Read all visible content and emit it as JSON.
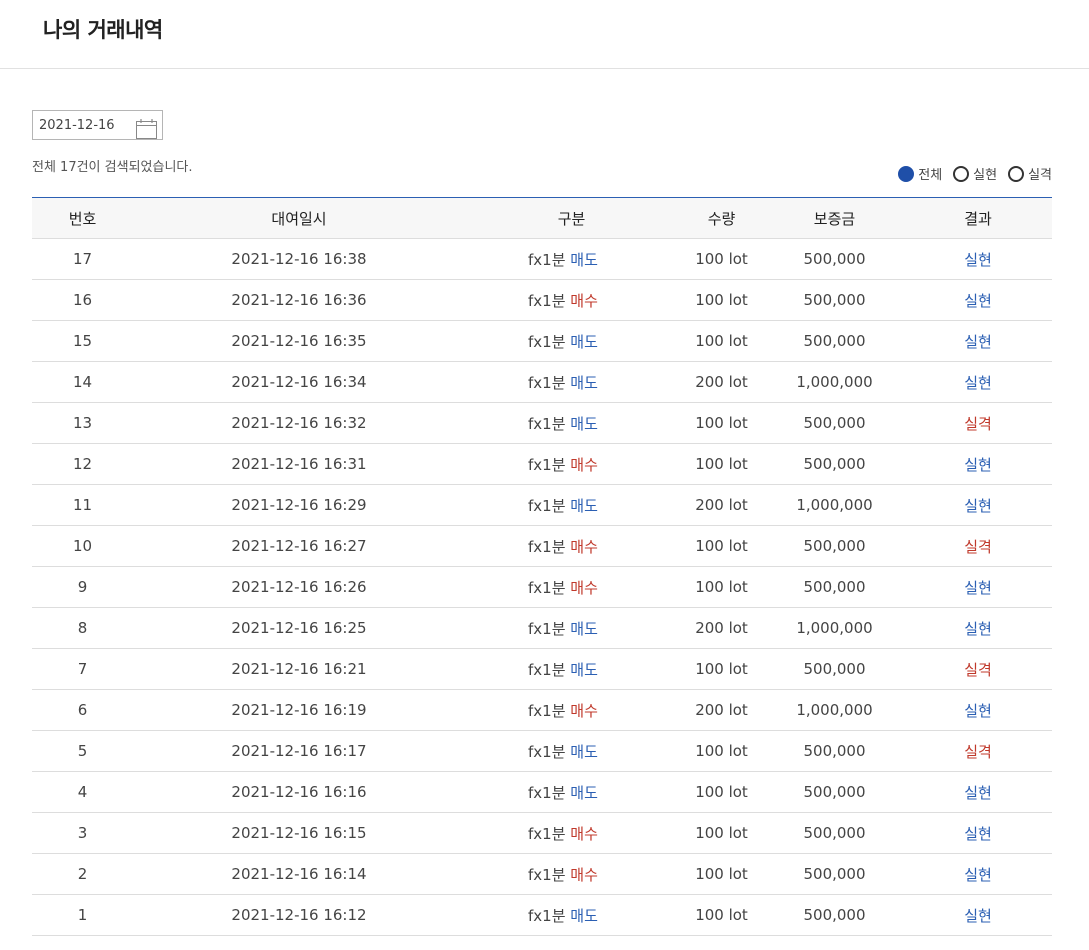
{
  "header": {
    "title": "나의 거래내역"
  },
  "search": {
    "date": "2021-12-16",
    "result_text": "전체 17건이 검색되었습니다."
  },
  "filters": [
    {
      "label": "전체",
      "checked": true
    },
    {
      "label": "실현",
      "checked": false
    },
    {
      "label": "실격",
      "checked": false
    }
  ],
  "table": {
    "columns": [
      "번호",
      "대여일시",
      "구분",
      "수량",
      "보증금",
      "결과"
    ],
    "rows": [
      {
        "no": "17",
        "datetime": "2021-12-16 16:38",
        "product": "fx1분",
        "side": "매도",
        "qty": "100 lot",
        "deposit": "500,000",
        "result": "실현"
      },
      {
        "no": "16",
        "datetime": "2021-12-16 16:36",
        "product": "fx1분",
        "side": "매수",
        "qty": "100 lot",
        "deposit": "500,000",
        "result": "실현"
      },
      {
        "no": "15",
        "datetime": "2021-12-16 16:35",
        "product": "fx1분",
        "side": "매도",
        "qty": "100 lot",
        "deposit": "500,000",
        "result": "실현"
      },
      {
        "no": "14",
        "datetime": "2021-12-16 16:34",
        "product": "fx1분",
        "side": "매도",
        "qty": "200 lot",
        "deposit": "1,000,000",
        "result": "실현"
      },
      {
        "no": "13",
        "datetime": "2021-12-16 16:32",
        "product": "fx1분",
        "side": "매도",
        "qty": "100 lot",
        "deposit": "500,000",
        "result": "실격"
      },
      {
        "no": "12",
        "datetime": "2021-12-16 16:31",
        "product": "fx1분",
        "side": "매수",
        "qty": "100 lot",
        "deposit": "500,000",
        "result": "실현"
      },
      {
        "no": "11",
        "datetime": "2021-12-16 16:29",
        "product": "fx1분",
        "side": "매도",
        "qty": "200 lot",
        "deposit": "1,000,000",
        "result": "실현"
      },
      {
        "no": "10",
        "datetime": "2021-12-16 16:27",
        "product": "fx1분",
        "side": "매수",
        "qty": "100 lot",
        "deposit": "500,000",
        "result": "실격"
      },
      {
        "no": "9",
        "datetime": "2021-12-16 16:26",
        "product": "fx1분",
        "side": "매수",
        "qty": "100 lot",
        "deposit": "500,000",
        "result": "실현"
      },
      {
        "no": "8",
        "datetime": "2021-12-16 16:25",
        "product": "fx1분",
        "side": "매도",
        "qty": "200 lot",
        "deposit": "1,000,000",
        "result": "실현"
      },
      {
        "no": "7",
        "datetime": "2021-12-16 16:21",
        "product": "fx1분",
        "side": "매도",
        "qty": "100 lot",
        "deposit": "500,000",
        "result": "실격"
      },
      {
        "no": "6",
        "datetime": "2021-12-16 16:19",
        "product": "fx1분",
        "side": "매수",
        "qty": "200 lot",
        "deposit": "1,000,000",
        "result": "실현"
      },
      {
        "no": "5",
        "datetime": "2021-12-16 16:17",
        "product": "fx1분",
        "side": "매도",
        "qty": "100 lot",
        "deposit": "500,000",
        "result": "실격"
      },
      {
        "no": "4",
        "datetime": "2021-12-16 16:16",
        "product": "fx1분",
        "side": "매도",
        "qty": "100 lot",
        "deposit": "500,000",
        "result": "실현"
      },
      {
        "no": "3",
        "datetime": "2021-12-16 16:15",
        "product": "fx1분",
        "side": "매수",
        "qty": "100 lot",
        "deposit": "500,000",
        "result": "실현"
      },
      {
        "no": "2",
        "datetime": "2021-12-16 16:14",
        "product": "fx1분",
        "side": "매수",
        "qty": "100 lot",
        "deposit": "500,000",
        "result": "실현"
      },
      {
        "no": "1",
        "datetime": "2021-12-16 16:12",
        "product": "fx1분",
        "side": "매도",
        "qty": "100 lot",
        "deposit": "500,000",
        "result": "실현"
      }
    ]
  },
  "colors": {
    "accent_blue": "#2b5fb3",
    "accent_red": "#c0392b",
    "radio_checked": "#1f4fa8"
  },
  "icons": {
    "date_picker": "calendar-icon"
  }
}
